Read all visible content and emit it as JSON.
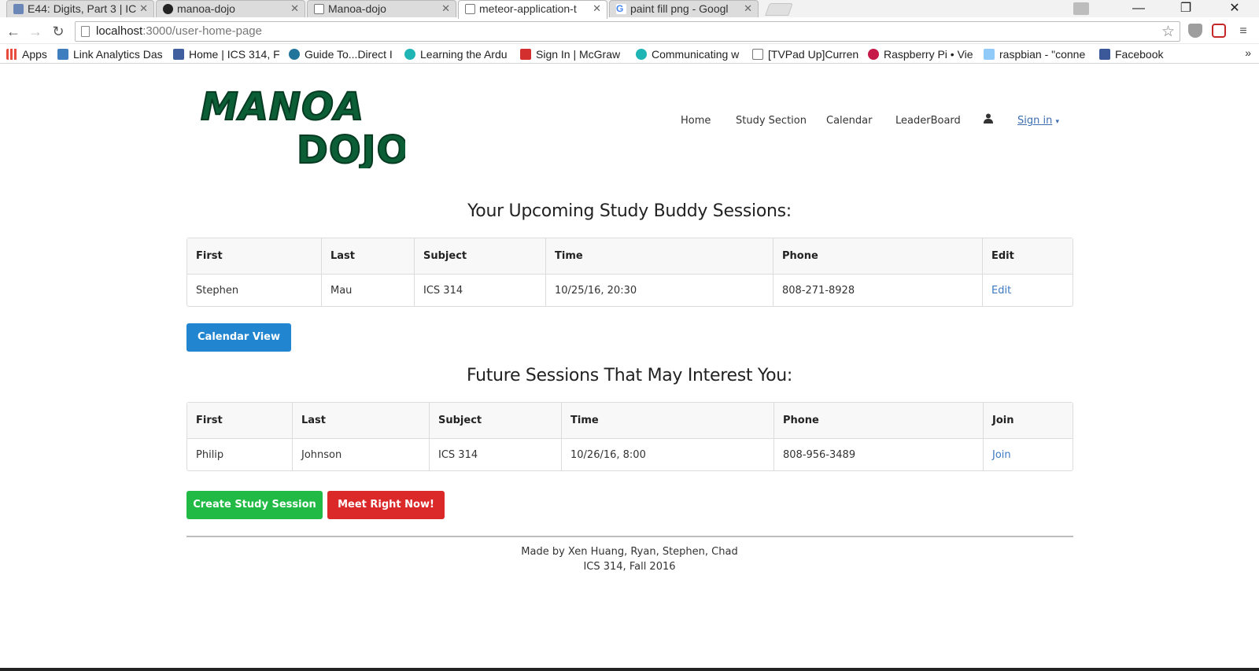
{
  "browser": {
    "tabs": [
      {
        "title": "E44: Digits, Part 3 | IC",
        "active": false
      },
      {
        "title": "manoa-dojo",
        "active": false
      },
      {
        "title": "Manoa-dojo",
        "active": false
      },
      {
        "title": "meteor-application-t",
        "active": true
      },
      {
        "title": "paint fill png - Googl",
        "active": false
      }
    ],
    "url_host": "localhost",
    "url_rest": ":3000/user-home-page",
    "bookmarks": [
      {
        "label": "Apps",
        "icon": "apps-grid-icon"
      },
      {
        "label": "Link Analytics Das",
        "icon": "tuc-icon"
      },
      {
        "label": "Home | ICS 314, F",
        "icon": "page-icon"
      },
      {
        "label": "Guide To...Direct I",
        "icon": "wordpress-icon"
      },
      {
        "label": "Learning the Ardu",
        "icon": "circle-icon"
      },
      {
        "label": "Sign In | McGraw",
        "icon": "mcgraw-icon"
      },
      {
        "label": "Communicating w",
        "icon": "circle-icon"
      },
      {
        "label": "[TVPad Up]Curren",
        "icon": "document-icon"
      },
      {
        "label": "Raspberry Pi • Vie",
        "icon": "raspberry-icon"
      },
      {
        "label": "raspbian - \"conne",
        "icon": "rpi-icon"
      },
      {
        "label": "Facebook",
        "icon": "facebook-icon"
      }
    ],
    "bookmarks_more": "»"
  },
  "brand": {
    "logo_line1": "MANOA",
    "logo_line2": "DOJO",
    "logo_color": "#0b5e36"
  },
  "nav": {
    "home": "Home",
    "study_section": "Study Section",
    "calendar": "Calendar",
    "leaderboard": "LeaderBoard",
    "signin": "Sign in",
    "signin_caret": "▾"
  },
  "upcoming": {
    "title": "Your Upcoming Study Buddy Sessions:",
    "headers": [
      "First",
      "Last",
      "Subject",
      "Time",
      "Phone",
      "Edit"
    ],
    "rows": [
      {
        "first": "Stephen",
        "last": "Mau",
        "subject": "ICS 314",
        "time": "10/25/16, 20:30",
        "phone": "808-271-8928",
        "action": "Edit"
      }
    ],
    "calendar_button": "Calendar View"
  },
  "future": {
    "title": "Future Sessions That May Interest You:",
    "headers": [
      "First",
      "Last",
      "Subject",
      "Time",
      "Phone",
      "Join"
    ],
    "rows": [
      {
        "first": "Philip",
        "last": "Johnson",
        "subject": "ICS 314",
        "time": "10/26/16, 8:00",
        "phone": "808-956-3489",
        "action": "Join"
      }
    ],
    "create_button": "Create Study Session",
    "meet_button": "Meet Right Now!"
  },
  "footer": {
    "line1": "Made by Xen Huang, Ryan, Stephen, Chad",
    "line2": "ICS 314, Fall 2016"
  },
  "colors": {
    "blue": "#2185d0",
    "green": "#21ba45",
    "red": "#db2828",
    "link": "#3b78c2"
  }
}
